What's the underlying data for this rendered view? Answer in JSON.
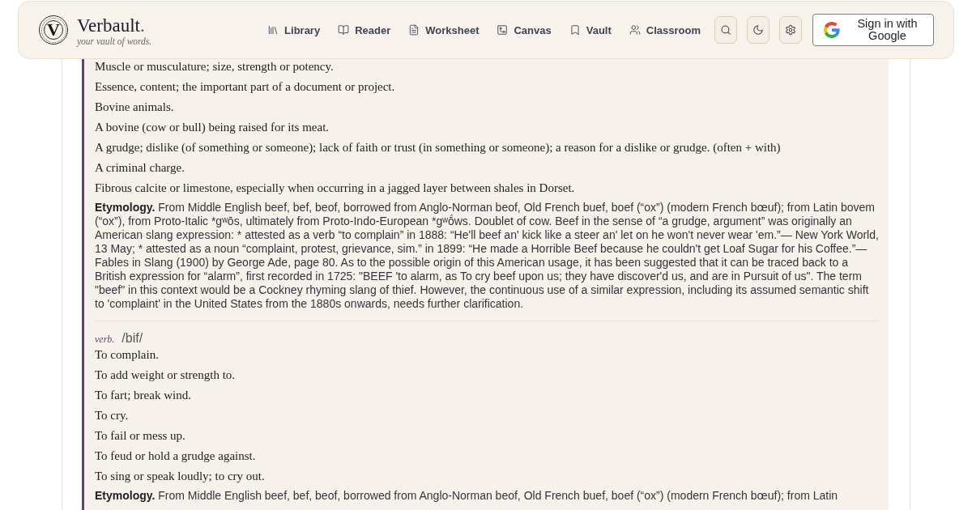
{
  "header": {
    "logo": {
      "letter": "V"
    },
    "brand": {
      "name": "Verbault",
      "mark": "."
    },
    "tagline": "your vault of words.",
    "nav": [
      {
        "label": "Library",
        "selected": false
      },
      {
        "label": "Reader",
        "selected": false
      },
      {
        "label": "Worksheet",
        "selected": false
      },
      {
        "label": "Canvas",
        "selected": false
      },
      {
        "label": "Vault",
        "selected": false
      },
      {
        "label": "Classroom",
        "selected": false
      }
    ],
    "sign_in": {
      "label": "Sign in with Google"
    }
  },
  "entry": {
    "sections": [
      {
        "definitions": [
          "Muscle or musculature; size, strength or potency.",
          "Essence, content; the important part of a document or project.",
          "Bovine animals.",
          "A bovine (cow or bull) being raised for its meat.",
          "A grudge; dislike (of something or someone); lack of faith or trust (in something or someone); a reason for a dislike or grudge. (often + with)",
          "A criminal charge.",
          "Fibrous calcite or limestone, especially when occurring in a jagged layer between shales in Dorset."
        ],
        "etymology": {
          "label": "Etymology.",
          "text": "From Middle English beef, bef, beof, borrowed from Anglo-Norman beof, Old French buef, boef (“ox”) (modern French bœuf); from Latin bovem (“ox”), from Proto-Italic *gʷōs, ultimately from Proto-Indo-European *gʷṓws. Doublet of cow. Beef in the sense of “a grudge, argument” was originally an American slang expression: * attested as a verb “to complain” in 1888: “He'll beef an' kick like a steer an' let on he won't never wear 'em.”— New York World, 13 May; * attested as a noun “complaint, protest, grievance, sim.” in 1899: “He made a Horrible Beef because he couldn't get Loaf Sugar for his Coffee.”—Fables in Slang (1900) by George Ade, page 80. As to the possible origin of this American usage, it has been suggested that it can be traced back to a British expression for “alarm”, first recorded in 1725: \"BEEF 'to alarm, as To cry beef upon us; they have discover'd us, and are in Pursuit of us\". The term \"beef\" in this context would be a Cockney rhyming slang of thief. However, the continuous use of a similar expression, including its assumed semantic shift to 'complaint' in the United States from the 1880s onwards, needs further clarification."
        }
      },
      {
        "part_of_speech": "verb.",
        "pronunciation": "/bif/",
        "definitions": [
          "To complain.",
          "To add weight or strength to.",
          "To fart; break wind.",
          "To cry.",
          "To fail or mess up.",
          "To feud or hold a grudge against.",
          "To sing or speak loudly; to cry out."
        ],
        "etymology": {
          "label": "Etymology.",
          "text": "From Middle English beef, bef, beof, borrowed from Anglo-Norman beof, Old French buef, boef (“ox”) (modern French bœuf); from Latin"
        }
      }
    ]
  }
}
